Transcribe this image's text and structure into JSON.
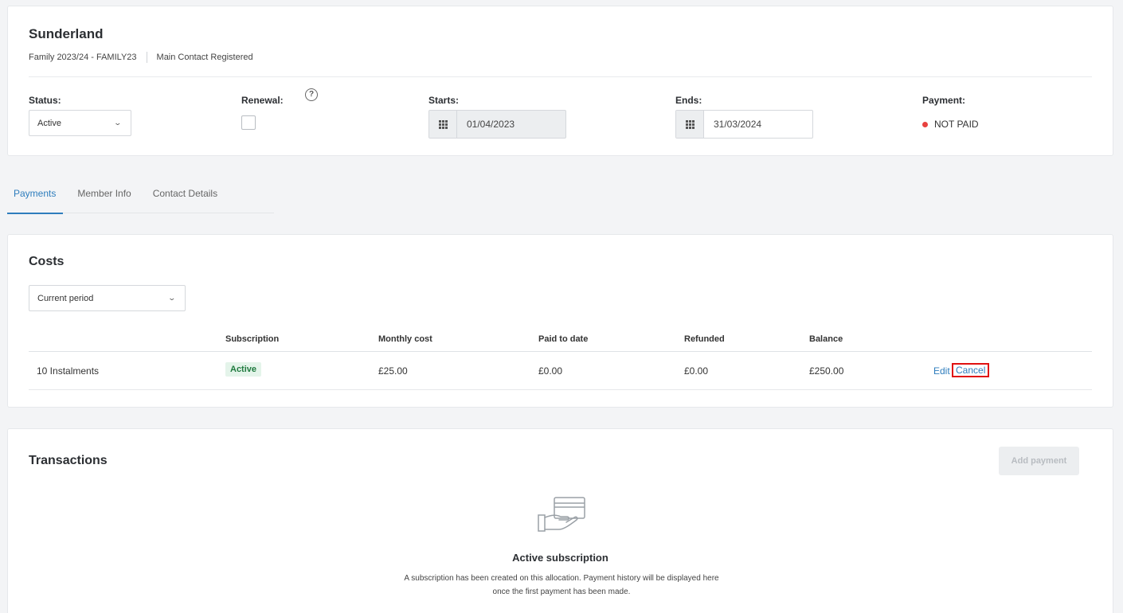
{
  "header": {
    "club_name": "Sunderland",
    "membership": "Family 2023/24 - FAMILY23",
    "contact_status": "Main Contact Registered",
    "status_label": "Status:",
    "status_value": "Active",
    "renewal_label": "Renewal:",
    "renewal_checked": false,
    "help_glyph": "?",
    "starts_label": "Starts:",
    "starts_value": "01/04/2023",
    "ends_label": "Ends:",
    "ends_value": "31/03/2024",
    "payment_label": "Payment:",
    "payment_value": "NOT PAID",
    "payment_color": "#e8413f"
  },
  "tabs": [
    {
      "label": "Payments",
      "active": true
    },
    {
      "label": "Member Info",
      "active": false
    },
    {
      "label": "Contact Details",
      "active": false
    }
  ],
  "costs": {
    "title": "Costs",
    "period_select": "Current period",
    "columns": [
      "Subscription",
      "Monthly cost",
      "Paid to date",
      "Refunded",
      "Balance"
    ],
    "rows": [
      {
        "name": "10 Instalments",
        "subscription": "Active",
        "monthly_cost": "£25.00",
        "paid_to_date": "£0.00",
        "refunded": "£0.00",
        "balance": "£250.00",
        "edit_label": "Edit",
        "cancel_label": "Cancel"
      }
    ]
  },
  "transactions": {
    "title": "Transactions",
    "add_payment_label": "Add payment",
    "empty_icon": "card-in-hand-icon",
    "empty_title": "Active subscription",
    "empty_text": "A subscription has been created on this allocation. Payment history will be displayed here once the first payment has been made."
  },
  "colors": {
    "accent": "#2e7dbd",
    "highlight": "#e01010",
    "badge_green": "#1f7a3e"
  }
}
